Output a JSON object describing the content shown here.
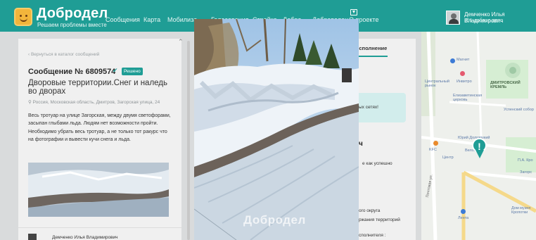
{
  "header": {
    "logo_title": "Добродел",
    "logo_subtitle": "Решаем проблемы вместе",
    "nav": [
      "Сообщения",
      "Карта",
      "Мобилиза",
      "Голосования",
      "Стройка",
      "Добро",
      "Доброволец",
      "О проекте"
    ],
    "user_name": "Демченко Илья Владимирович",
    "user_karma": "351 доброе дело"
  },
  "card": {
    "back_link": "‹ Вернуться в каталог сообщений",
    "title": "Сообщение № 6809574",
    "status": "Решено",
    "category": "Дворовые территории.Снег и наледь во дворах",
    "address": "Россия, Московская область, Дмитров, Загорская улица, 24",
    "description": "Весь тротуар на улице Загорская, между двумя светофорами, засыпан глыбами льда. Людям нет возможности пройти. Необходимо убрать весь тротуар, а не только тот ракурс что на фотографии и вывести кучи снега и льда.",
    "author": "Демченко Илья Владимирович"
  },
  "right_panel": {
    "tab_active": "Исполнение",
    "notice": "ых сетях!",
    "heading": "ч",
    "line1": "е как успешно",
    "line2": "ого округа",
    "line3": "ржания территорий",
    "line4": "сполнителя :"
  },
  "map": {
    "labels": [
      "Магнит",
      "Центральный рынок",
      "Инвитро",
      "ДМИТРОВСКИЙ КРЕМЛЬ",
      "Елизаветинская церковь",
      "Успенский собор",
      "Юрий Долгорукий",
      "KFC",
      "Велоспорт",
      "Центр",
      "П.А. Кро",
      "Загорс",
      "Лента",
      "Дом музея Кропотки",
      "Почтовая ул."
    ]
  },
  "photo": {
    "watermark": "Добродел"
  }
}
